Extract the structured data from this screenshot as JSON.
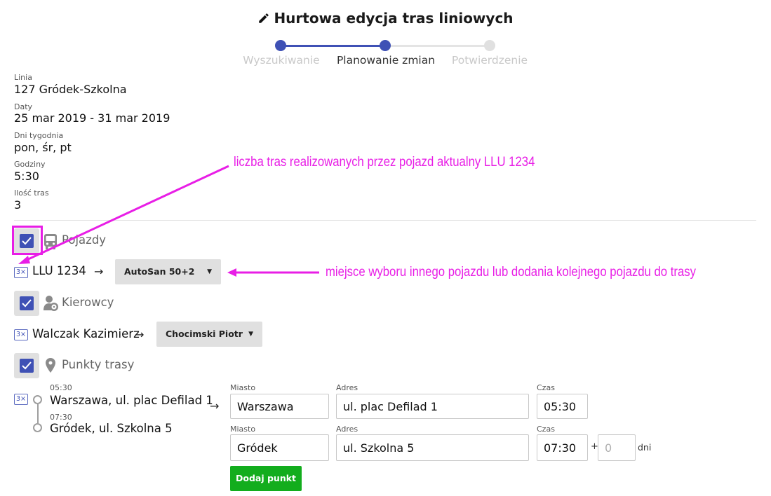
{
  "header": {
    "title": "Hurtowa edycja tras liniowych",
    "icon": "pencil-icon"
  },
  "wizard": {
    "steps": [
      {
        "label": "Wyszukiwanie",
        "state": "done"
      },
      {
        "label": "Planowanie zmian",
        "state": "current"
      },
      {
        "label": "Potwierdzenie",
        "state": "todo"
      }
    ]
  },
  "summary": {
    "linia_label": "Linia",
    "linia": "127 Gródek-Szkolna",
    "daty_label": "Daty",
    "daty": "25 mar 2019 - 31 mar 2019",
    "dni_label": "Dni tygodnia",
    "dni": "pon, śr, pt",
    "godziny_label": "Godziny",
    "godziny": "5:30",
    "ilosc_label": "Ilość tras",
    "ilosc": "3"
  },
  "vehicles": {
    "section_label": "Pojazdy",
    "checked": true,
    "icon": "bus-icon",
    "count_badge": "3×",
    "current": "LLU 1234",
    "arrow": "→",
    "selected": "AutoSan 50+2"
  },
  "drivers": {
    "section_label": "Kierowcy",
    "checked": true,
    "icon": "driver-icon",
    "count_badge": "3×",
    "current": "Walczak Kazimierz",
    "arrow": "→",
    "selected": "Chocimski Piotr"
  },
  "points": {
    "section_label": "Punkty trasy",
    "checked": true,
    "icon": "map-pin-icon",
    "count_badge": "3×",
    "arrow": "→",
    "stops": [
      {
        "time": "05:30",
        "name": "Warszawa, ul. plac Defilad 1"
      },
      {
        "time": "07:30",
        "name": "Gródek, ul. Szkolna 5"
      }
    ],
    "edit_rows": [
      {
        "miasto_label": "Miasto",
        "miasto": "Warszawa",
        "adres_label": "Adres",
        "adres": "ul. plac Defilad 1",
        "czas_label": "Czas",
        "czas": "05:30"
      },
      {
        "miasto_label": "Miasto",
        "miasto": "Gródek",
        "adres_label": "Adres",
        "adres": "ul. Szkolna 5",
        "czas_label": "Czas",
        "czas": "07:30",
        "plus": "+",
        "dni_placeholder": "0",
        "dni_label": "dni"
      }
    ],
    "add_button": "Dodaj punkt"
  },
  "annotations": {
    "top": "liczba tras realizowanych przez pojazd aktualny LLU 1234",
    "right": "miejsce wyboru innego pojazdu lub dodania kolejnego pojazdu do trasy"
  },
  "colors": {
    "accent": "#3f51b5",
    "annotation": "#e81ee6",
    "add_button": "#13ad1d",
    "muted_step": "#c9c9c9"
  }
}
